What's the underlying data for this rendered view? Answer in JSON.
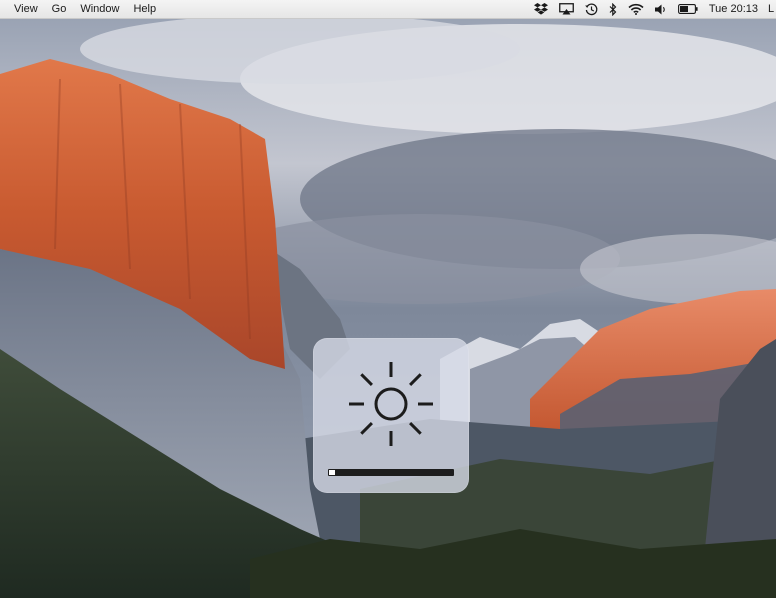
{
  "menubar": {
    "menus": [
      {
        "label": "View"
      },
      {
        "label": "Go"
      },
      {
        "label": "Window"
      },
      {
        "label": "Help"
      }
    ],
    "status_icons": [
      "dropbox-icon",
      "airplay-icon",
      "time-machine-icon",
      "bluetooth-icon",
      "wifi-icon",
      "volume-icon",
      "battery-icon"
    ],
    "clock": "Tue 20:13",
    "user_initial": "L"
  },
  "brightness_hud": {
    "icon": "sun-icon",
    "level_fraction": 0.05
  },
  "colors": {
    "hud_background": "#d6dae6",
    "hud_bar": "#1d1d1d",
    "hud_fill": "#ffffff"
  }
}
